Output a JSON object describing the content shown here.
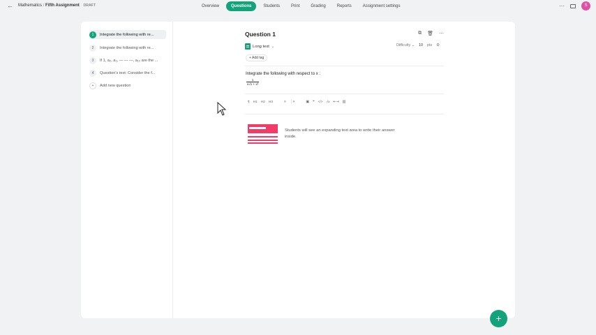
{
  "breadcrumb": {
    "course": "Mathematics",
    "separator": "/",
    "assignment": "Fifth Assignment",
    "status": "DRAFT"
  },
  "nav": {
    "tabs": [
      "Overview",
      "Questions",
      "Students",
      "Print",
      "Grading",
      "Reports",
      "Assignment settings"
    ],
    "active": "Questions"
  },
  "user": {
    "initial": "S"
  },
  "questions": [
    {
      "num": "1",
      "label": "Integrate the following with re..."
    },
    {
      "num": "2",
      "label": "Integrate the following with re..."
    },
    {
      "num": "3",
      "label": "If 1, a₂, a₃, — — —, a₁₀ are the ..."
    },
    {
      "num": "4",
      "label": "Question's text: Consider the f..."
    }
  ],
  "add_new": {
    "icon": "+",
    "label": "Add new question"
  },
  "question": {
    "title": "Question 1",
    "type": "Long text",
    "difficulty_label": "Difficulty",
    "points": "10",
    "points_unit": "pts",
    "add_tag": "+ Add tag",
    "prompt": "Integrate the following with respect to x :",
    "frac_num": "1",
    "frac_den": "x√1 + x²",
    "hint": "Students will see an expanding text area to write their answer inside."
  },
  "toolbar": [
    "¶",
    "H1",
    "H2",
    "H3",
    "≡",
    "⋮≡",
    "▣",
    "❝",
    "</>",
    "√x",
    "⇤⇥",
    "▥"
  ],
  "fab": {
    "label": "+"
  },
  "colors": {
    "accent": "#13a37a",
    "preview": "#f23b66",
    "avatar": "#e04fa6"
  }
}
